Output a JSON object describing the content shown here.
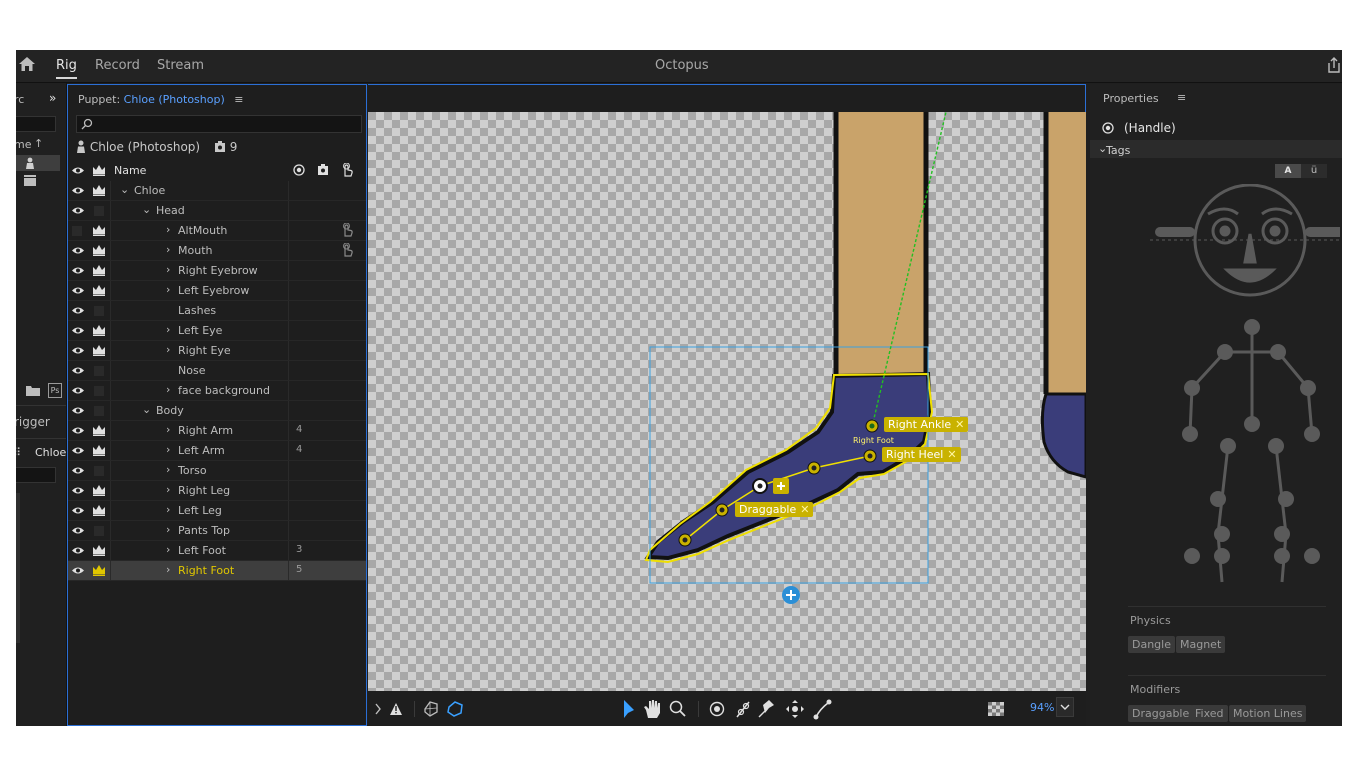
{
  "app": {
    "title": "Octopus",
    "tabs": [
      {
        "label": "Rig",
        "active": true
      },
      {
        "label": "Record",
        "active": false
      },
      {
        "label": "Stream",
        "active": false
      }
    ]
  },
  "left_strip": {
    "header_fragment": "rc",
    "name_column_fragment": "me",
    "trigger_fragment": "rigger",
    "chloe_label": "Chloe"
  },
  "puppet_panel": {
    "header_prefix": "Puppet:",
    "puppet_name": "Chloe (Photoshop)",
    "title": "Chloe (Photoshop)",
    "count": "9",
    "columns": {
      "name": "Name"
    },
    "rows": [
      {
        "name": "Chloe",
        "indent": 1,
        "expand": "open",
        "eye": true,
        "crown": true,
        "count": "",
        "trigger": false,
        "selected": false
      },
      {
        "name": "Head",
        "indent": 2,
        "expand": "open",
        "eye": true,
        "crown": false,
        "count": "",
        "trigger": false,
        "selected": false
      },
      {
        "name": "AltMouth",
        "indent": 3,
        "expand": "closed",
        "eye": false,
        "crown": true,
        "count": "",
        "trigger": true,
        "selected": false
      },
      {
        "name": "Mouth",
        "indent": 3,
        "expand": "closed",
        "eye": true,
        "crown": true,
        "count": "",
        "trigger": true,
        "selected": false
      },
      {
        "name": "Right Eyebrow",
        "indent": 3,
        "expand": "closed",
        "eye": true,
        "crown": true,
        "count": "",
        "trigger": false,
        "selected": false
      },
      {
        "name": "Left Eyebrow",
        "indent": 3,
        "expand": "closed",
        "eye": true,
        "crown": true,
        "count": "",
        "trigger": false,
        "selected": false
      },
      {
        "name": "Lashes",
        "indent": 3,
        "expand": "none",
        "eye": true,
        "crown": false,
        "count": "",
        "trigger": false,
        "selected": false
      },
      {
        "name": "Left Eye",
        "indent": 3,
        "expand": "closed",
        "eye": true,
        "crown": true,
        "count": "",
        "trigger": false,
        "selected": false
      },
      {
        "name": "Right Eye",
        "indent": 3,
        "expand": "closed",
        "eye": true,
        "crown": true,
        "count": "",
        "trigger": false,
        "selected": false
      },
      {
        "name": "Nose",
        "indent": 3,
        "expand": "none",
        "eye": true,
        "crown": false,
        "count": "",
        "trigger": false,
        "selected": false
      },
      {
        "name": "face background",
        "indent": 3,
        "expand": "closed",
        "eye": true,
        "crown": false,
        "count": "",
        "trigger": false,
        "selected": false
      },
      {
        "name": "Body",
        "indent": 2,
        "expand": "open",
        "eye": true,
        "crown": false,
        "count": "",
        "trigger": false,
        "selected": false
      },
      {
        "name": "Right Arm",
        "indent": 3,
        "expand": "closed",
        "eye": true,
        "crown": true,
        "count": "4",
        "trigger": false,
        "selected": false
      },
      {
        "name": "Left Arm",
        "indent": 3,
        "expand": "closed",
        "eye": true,
        "crown": true,
        "count": "4",
        "trigger": false,
        "selected": false
      },
      {
        "name": "Torso",
        "indent": 3,
        "expand": "closed",
        "eye": true,
        "crown": false,
        "count": "",
        "trigger": false,
        "selected": false
      },
      {
        "name": "Right Leg",
        "indent": 3,
        "expand": "closed",
        "eye": true,
        "crown": true,
        "count": "",
        "trigger": false,
        "selected": false
      },
      {
        "name": "Left Leg",
        "indent": 3,
        "expand": "closed",
        "eye": true,
        "crown": true,
        "count": "",
        "trigger": false,
        "selected": false
      },
      {
        "name": "Pants Top",
        "indent": 3,
        "expand": "closed",
        "eye": true,
        "crown": false,
        "count": "",
        "trigger": false,
        "selected": false
      },
      {
        "name": "Left Foot",
        "indent": 3,
        "expand": "closed",
        "eye": true,
        "crown": true,
        "count": "3",
        "trigger": false,
        "selected": false
      },
      {
        "name": "Right Foot",
        "indent": 3,
        "expand": "closed",
        "eye": true,
        "crown": true,
        "count": "5",
        "trigger": false,
        "selected": true
      }
    ]
  },
  "canvas": {
    "tags": {
      "right_ankle": "Right Ankle",
      "right_heel": "Right Heel",
      "draggable": "Draggable",
      "right_foot_small": "Right Foot"
    },
    "zoom": "94%"
  },
  "properties": {
    "title": "Properties",
    "handle_label": "(Handle)",
    "tags_header": "Tags",
    "seg_a": "A",
    "seg_b": "ü",
    "physics_label": "Physics",
    "physics_tags": [
      "Dangle",
      "Magnet"
    ],
    "modifiers_label": "Modifiers",
    "modifier_tags": [
      "Draggable",
      "Fixed",
      "Motion Lines"
    ]
  },
  "colors": {
    "selected_yellow": "#e0c700",
    "tag_yellow": "#c9b200",
    "accent_blue": "#2b6fd6",
    "foot_blue": "#3a3d7a",
    "skin": "#c9a36a"
  }
}
